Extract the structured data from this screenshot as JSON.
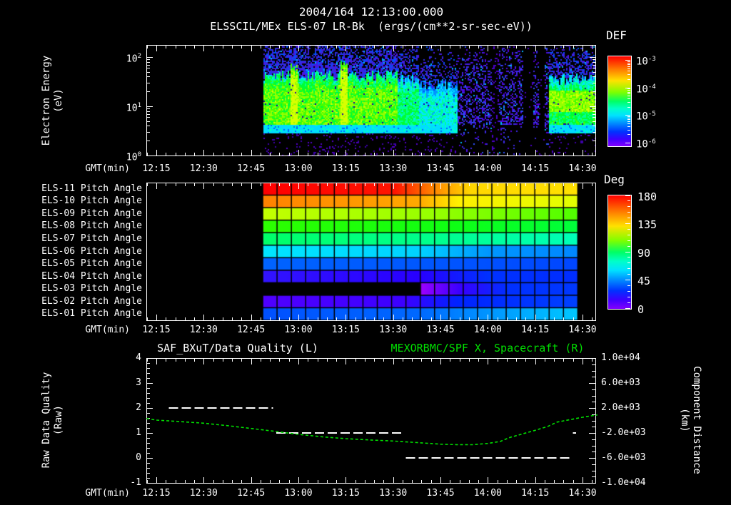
{
  "header": {
    "title_line1": "2004/164 12:13:00.000",
    "title_line2": "ELSSCIL/MEx ELS-07 LR-Bk  (ergs/(cm**2-sr-sec-eV))"
  },
  "axes": {
    "gmt_label": "GMT(min)",
    "time_ticks": [
      "12:15",
      "12:30",
      "12:45",
      "13:00",
      "13:15",
      "13:30",
      "13:45",
      "14:00",
      "14:15",
      "14:30"
    ]
  },
  "panel1": {
    "ylabel_line1": "Electron Energy",
    "ylabel_line2": "(eV)",
    "yticks": [
      {
        "base": "10",
        "exp": "2"
      },
      {
        "base": "10",
        "exp": "1"
      },
      {
        "base": "10",
        "exp": "0"
      }
    ],
    "colorbar": {
      "title": "DEF",
      "ticks": [
        {
          "base": "10",
          "exp": "-3"
        },
        {
          "base": "10",
          "exp": "-4"
        },
        {
          "base": "10",
          "exp": "-5"
        },
        {
          "base": "10",
          "exp": "-6"
        }
      ]
    }
  },
  "panel2": {
    "row_labels": [
      "ELS-11 Pitch Angle",
      "ELS-10 Pitch Angle",
      "ELS-09 Pitch Angle",
      "ELS-08 Pitch Angle",
      "ELS-07 Pitch Angle",
      "ELS-06 Pitch Angle",
      "ELS-05 Pitch Angle",
      "ELS-04 Pitch Angle",
      "ELS-03 Pitch Angle",
      "ELS-02 Pitch Angle",
      "ELS-01 Pitch Angle"
    ],
    "colorbar": {
      "title": "Deg",
      "ticks": [
        "180",
        "135",
        "90",
        "45",
        "0"
      ]
    }
  },
  "panel3": {
    "title_left": "SAF_BXuT/Data Quality (L)",
    "title_right": "MEXORBMC/SPF X, Spacecraft (R)",
    "ylabel_left_line1": "Raw Data Quality",
    "ylabel_left_line2": "(Raw)",
    "ylabel_right_line1": "Component Distance",
    "ylabel_right_line2": "(km)",
    "yticks_left": [
      "4",
      "3",
      "2",
      "1",
      "0",
      "-1"
    ],
    "yticks_right": [
      "1.0e+04",
      "6.0e+03",
      "2.0e+03",
      "-2.0e+03",
      "-6.0e+03",
      "-1.0e+04"
    ]
  },
  "colors": {
    "background": "#000000",
    "text": "#ffffff",
    "green_series": "#00e000",
    "quality_series": "#ffffff"
  },
  "chart_data": [
    {
      "type": "heatmap",
      "name": "electron_energy_spectrogram",
      "title": "ELSSCIL/MEx ELS-07 LR-Bk",
      "units": "ergs/(cm**2-sr-sec-eV)",
      "date": "2004/164",
      "start_time": "12:13:00.000",
      "x_axis": {
        "label": "GMT(min)",
        "ticks": [
          "12:15",
          "12:30",
          "12:45",
          "13:00",
          "13:15",
          "13:30",
          "13:45",
          "14:00",
          "14:15",
          "14:30"
        ],
        "range_gmt": [
          "12:12",
          "14:35"
        ]
      },
      "y_axis": {
        "label": "Electron Energy (eV)",
        "scale": "log",
        "range_ev": [
          1,
          178
        ]
      },
      "colorbar": {
        "label": "DEF",
        "scale": "log",
        "range": [
          1e-06,
          0.001
        ]
      },
      "render": {
        "data_start_min": 48.7,
        "bands": [
          [
            48.7,
            91,
            45,
            0.92,
            0
          ],
          [
            91,
            98,
            38,
            0.62,
            0
          ],
          [
            98,
            110,
            30,
            0.45,
            0
          ],
          [
            139,
            154.8,
            38,
            0.68,
            1
          ]
        ],
        "speckle_epoch": [
          110,
          139
        ],
        "dropouts": [
          [
            121,
            123.5,
            0.15
          ],
          [
            131,
            134,
            0.03
          ],
          [
            136,
            138,
            0.03
          ]
        ],
        "bright_columns": [
          58.3,
          74.3
        ],
        "cyan_strip_ev": [
          3.0,
          4.3
        ]
      }
    },
    {
      "type": "heatmap",
      "name": "pitch_angle_rows",
      "colorbar": {
        "label": "Deg",
        "range": [
          0,
          180
        ]
      },
      "columns": 22,
      "data_window_min": [
        48.7,
        148.5
      ],
      "rows": [
        {
          "label": "ELS-11 Pitch Angle",
          "deg_left": 175,
          "deg_right": 140,
          "stops": [
            [
              0,
              "#ff0000"
            ],
            [
              0.42,
              "#ff1400"
            ],
            [
              0.55,
              "#ff8c00"
            ],
            [
              0.66,
              "#ffd700"
            ],
            [
              1,
              "#ffe100"
            ]
          ]
        },
        {
          "label": "ELS-10 Pitch Angle",
          "deg_left": 155,
          "deg_right": 130,
          "stops": [
            [
              0,
              "#ff8200"
            ],
            [
              0.5,
              "#ffaa00"
            ],
            [
              0.62,
              "#fff000"
            ],
            [
              1,
              "#e1ff00"
            ]
          ]
        },
        {
          "label": "ELS-09 Pitch Angle",
          "deg_left": 128,
          "deg_right": 115,
          "stops": [
            [
              0,
              "#c3ff00"
            ],
            [
              0.55,
              "#96ff00"
            ],
            [
              1,
              "#50ff00"
            ]
          ]
        },
        {
          "label": "ELS-08 Pitch Angle",
          "deg_left": 110,
          "deg_right": 104,
          "stops": [
            [
              0,
              "#2dff00"
            ],
            [
              0.6,
              "#0fff14"
            ],
            [
              1,
              "#00ff3c"
            ]
          ]
        },
        {
          "label": "ELS-07 Pitch Angle",
          "deg_left": 94,
          "deg_right": 88,
          "stops": [
            [
              0,
              "#00ff69"
            ],
            [
              0.6,
              "#00ff91"
            ],
            [
              1,
              "#00ffb9"
            ]
          ]
        },
        {
          "label": "ELS-06 Pitch Angle",
          "deg_left": 78,
          "deg_right": 68,
          "stops": [
            [
              0,
              "#00e6ff"
            ],
            [
              0.5,
              "#00d2ff"
            ],
            [
              0.72,
              "#0096ff"
            ],
            [
              1,
              "#0087ff"
            ]
          ]
        },
        {
          "label": "ELS-05 Pitch Angle",
          "deg_left": 55,
          "deg_right": 52,
          "stops": [
            [
              0,
              "#0064ff"
            ],
            [
              0.6,
              "#0055ff"
            ],
            [
              1,
              "#0046ff"
            ]
          ]
        },
        {
          "label": "ELS-04 Pitch Angle",
          "deg_left": 38,
          "deg_right": 46,
          "stops": [
            [
              0,
              "#3214ff"
            ],
            [
              0.5,
              "#2800ff"
            ],
            [
              0.72,
              "#0032ff"
            ],
            [
              1,
              "#002dff"
            ]
          ]
        },
        {
          "label": "ELS-03 Pitch Angle",
          "deg_left": 14,
          "deg_right": 46,
          "no_data_until_frac": 0.5,
          "start_gmt": "13:38",
          "stops": [
            [
              0,
              "#000000"
            ],
            [
              0.497,
              "#000000"
            ],
            [
              0.505,
              "#9b00ff"
            ],
            [
              0.55,
              "#7300ff"
            ],
            [
              0.63,
              "#3700ff"
            ],
            [
              0.78,
              "#0030ff"
            ],
            [
              1,
              "#0038ff"
            ]
          ]
        },
        {
          "label": "ELS-02 Pitch Angle",
          "deg_left": 25,
          "deg_right": 48,
          "stops": [
            [
              0,
              "#5000ff"
            ],
            [
              0.45,
              "#3c00ff"
            ],
            [
              0.62,
              "#0023ff"
            ],
            [
              1,
              "#0041ff"
            ]
          ]
        },
        {
          "label": "ELS-01 Pitch Angle",
          "deg_left": 52,
          "deg_right": 70,
          "stops": [
            [
              0,
              "#0050ff"
            ],
            [
              0.5,
              "#0069ff"
            ],
            [
              0.72,
              "#0096ff"
            ],
            [
              0.88,
              "#00b4ff"
            ],
            [
              1,
              "#00c8ff"
            ]
          ]
        }
      ]
    },
    {
      "type": "line",
      "name": "quality_and_distance",
      "x_axis": {
        "label": "GMT(min)",
        "ticks": [
          "12:15",
          "12:30",
          "12:45",
          "13:00",
          "13:15",
          "13:30",
          "13:45",
          "14:00",
          "14:15",
          "14:30"
        ]
      },
      "ylim_left": [
        -1,
        4
      ],
      "ylim_right": [
        -10000,
        10000
      ],
      "series": [
        {
          "name": "SAF_BXuT/Data Quality (L)",
          "axis": "left",
          "color": "#ffffff",
          "style": "dashed",
          "segments": [
            {
              "gmt_start": "12:19",
              "gmt_end": "12:52",
              "value": 2
            },
            {
              "gmt_start": "12:53",
              "gmt_end": "13:33",
              "value": 1
            },
            {
              "gmt_start": "13:34",
              "gmt_end": "14:27",
              "value": 0
            },
            {
              "gmt_start": "14:27",
              "gmt_end": "14:28",
              "value": 1
            }
          ]
        },
        {
          "name": "MEXORBMC/SPF X, Spacecraft (R)",
          "axis": "right",
          "color": "#00e000",
          "style": "dashed",
          "points_t_km": [
            [
              11.9,
              320
            ],
            [
              15,
              60
            ],
            [
              22,
              -160
            ],
            [
              30,
              -430
            ],
            [
              38,
              -860
            ],
            [
              45,
              -1280
            ],
            [
              52,
              -1700
            ],
            [
              60,
              -2230
            ],
            [
              68,
              -2640
            ],
            [
              75,
              -2915
            ],
            [
              83,
              -3130
            ],
            [
              90,
              -3290
            ],
            [
              98,
              -3560
            ],
            [
              105,
              -3795
            ],
            [
              110,
              -3870
            ],
            [
              115,
              -3890
            ],
            [
              120,
              -3680
            ],
            [
              124,
              -3350
            ],
            [
              127,
              -2720
            ],
            [
              131,
              -2150
            ],
            [
              135,
              -1578
            ],
            [
              139,
              -950
            ],
            [
              142,
              -250
            ],
            [
              146,
              130
            ],
            [
              150,
              515
            ],
            [
              154.7,
              890
            ]
          ]
        }
      ]
    }
  ]
}
